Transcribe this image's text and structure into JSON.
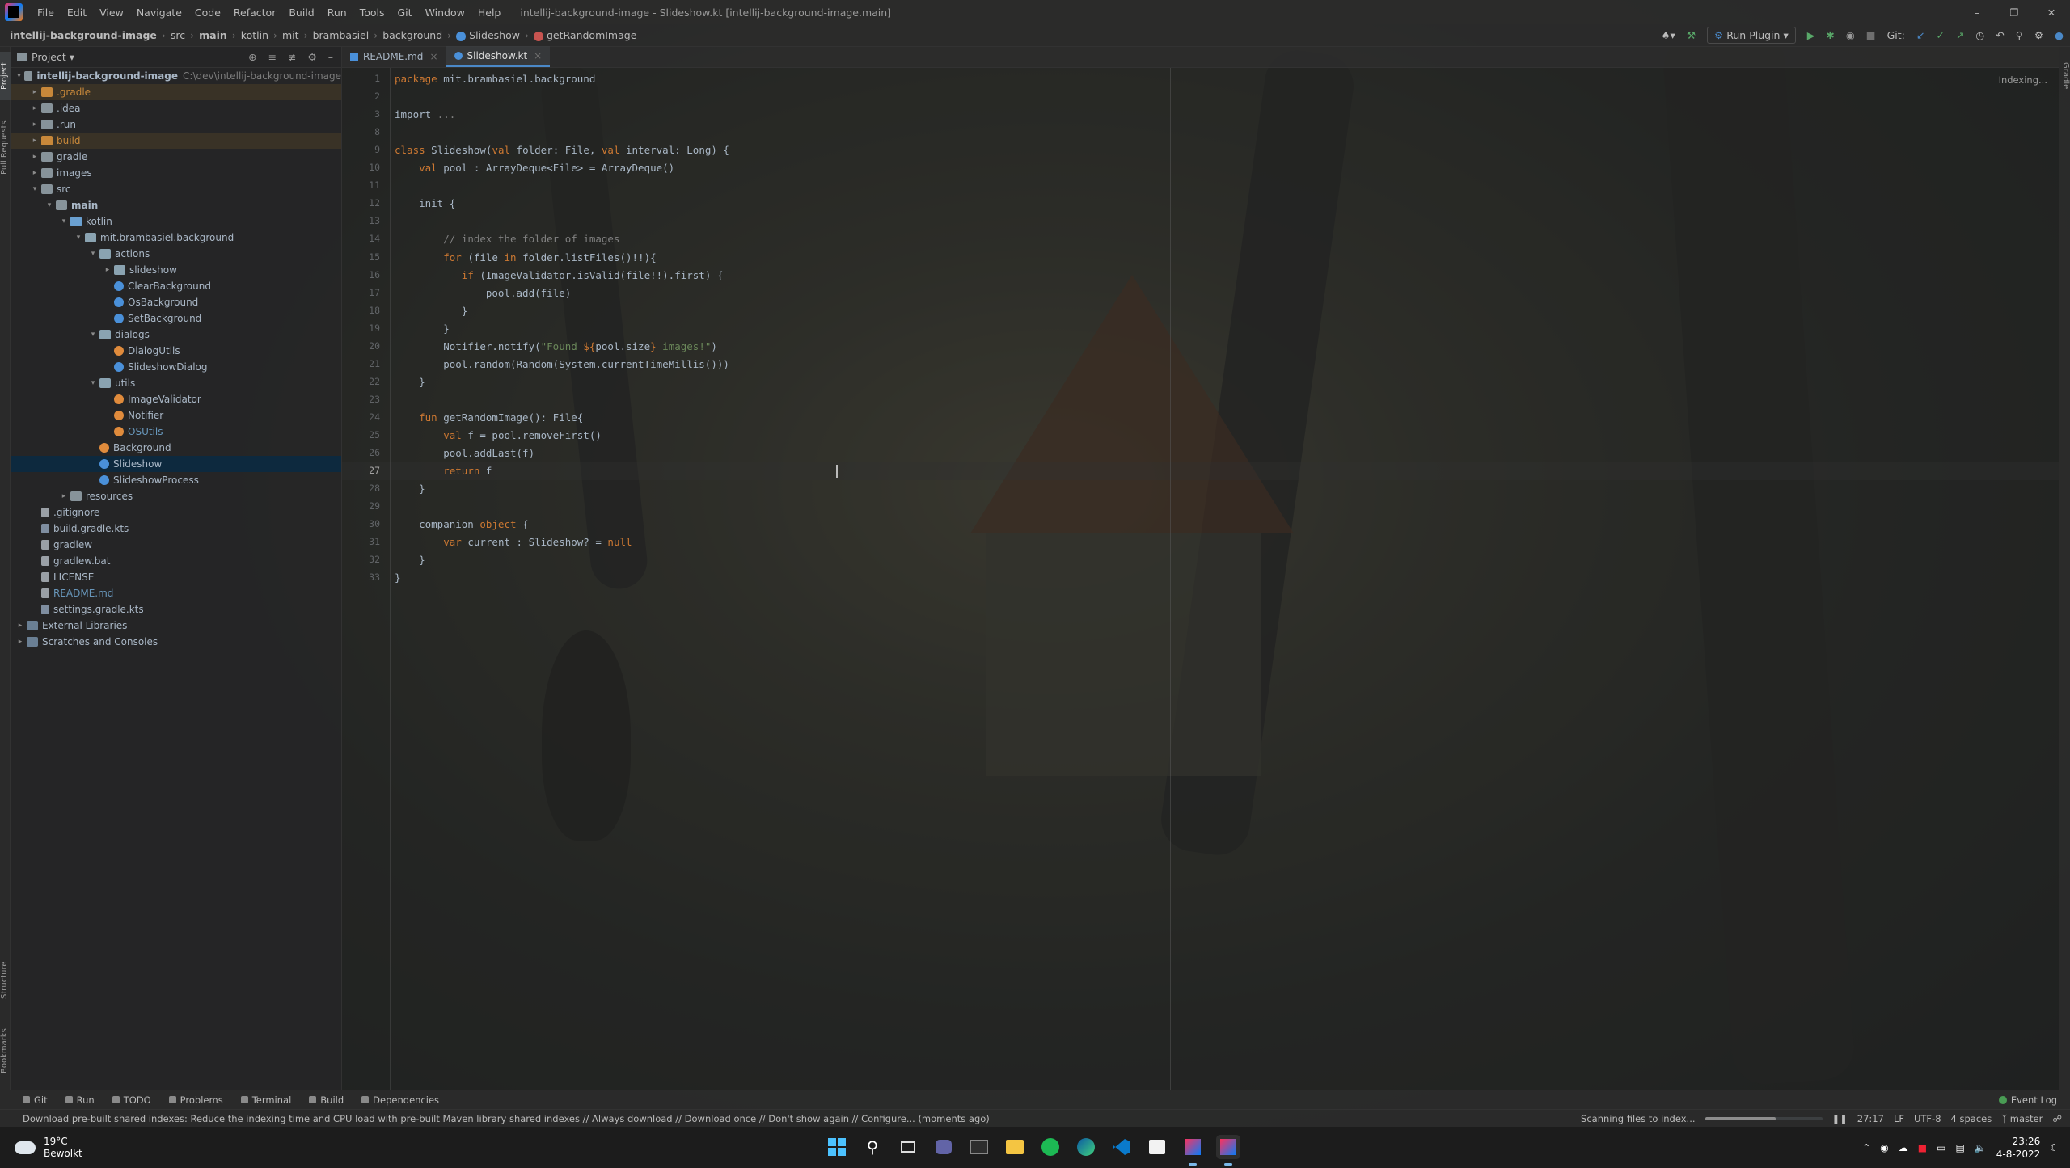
{
  "titlebar": {
    "menu": [
      "File",
      "Edit",
      "View",
      "Navigate",
      "Code",
      "Refactor",
      "Build",
      "Run",
      "Tools",
      "Git",
      "Window",
      "Help"
    ],
    "title": "intellij-background-image - Slideshow.kt [intellij-background-image.main]"
  },
  "breadcrumb": [
    "intellij-background-image",
    "src",
    "main",
    "kotlin",
    "mit",
    "brambasiel",
    "background",
    "Slideshow",
    "getRandomImage"
  ],
  "toolbar": {
    "run_config": "Run Plugin",
    "git_label": "Git:"
  },
  "project": {
    "header": "Project",
    "tree": [
      {
        "label": "intellij-background-image",
        "path": "C:\\dev\\intellij-background-image",
        "depth": 0,
        "icon": "folder",
        "open": true,
        "bold": true
      },
      {
        "label": ".gradle",
        "depth": 1,
        "icon": "folder-orange",
        "color": "#c8883a",
        "hl": true
      },
      {
        "label": ".idea",
        "depth": 1,
        "icon": "folder"
      },
      {
        "label": ".run",
        "depth": 1,
        "icon": "folder"
      },
      {
        "label": "build",
        "depth": 1,
        "icon": "folder-orange",
        "color": "#c8883a",
        "hl": true
      },
      {
        "label": "gradle",
        "depth": 1,
        "icon": "folder"
      },
      {
        "label": "images",
        "depth": 1,
        "icon": "folder"
      },
      {
        "label": "src",
        "depth": 1,
        "icon": "folder",
        "open": true
      },
      {
        "label": "main",
        "depth": 2,
        "icon": "folder",
        "open": true,
        "bold": true
      },
      {
        "label": "kotlin",
        "depth": 3,
        "icon": "folder-blue",
        "open": true
      },
      {
        "label": "mit.brambasiel.background",
        "depth": 4,
        "icon": "pkg",
        "open": true
      },
      {
        "label": "actions",
        "depth": 5,
        "icon": "pkg",
        "open": true
      },
      {
        "label": "slideshow",
        "depth": 6,
        "icon": "pkg"
      },
      {
        "label": "ClearBackground",
        "depth": 6,
        "icon": "kt",
        "leaf": true
      },
      {
        "label": "OsBackground",
        "depth": 6,
        "icon": "kt",
        "leaf": true
      },
      {
        "label": "SetBackground",
        "depth": 6,
        "icon": "kt",
        "leaf": true
      },
      {
        "label": "dialogs",
        "depth": 5,
        "icon": "pkg",
        "open": true
      },
      {
        "label": "DialogUtils",
        "depth": 6,
        "icon": "kto",
        "leaf": true
      },
      {
        "label": "SlideshowDialog",
        "depth": 6,
        "icon": "kt",
        "leaf": true
      },
      {
        "label": "utils",
        "depth": 5,
        "icon": "pkg",
        "open": true
      },
      {
        "label": "ImageValidator",
        "depth": 6,
        "icon": "kto",
        "leaf": true
      },
      {
        "label": "Notifier",
        "depth": 6,
        "icon": "kto",
        "leaf": true
      },
      {
        "label": "OSUtils",
        "depth": 6,
        "icon": "kto",
        "leaf": true,
        "color": "#6897bb"
      },
      {
        "label": "Background",
        "depth": 5,
        "icon": "kto",
        "leaf": true
      },
      {
        "label": "Slideshow",
        "depth": 5,
        "icon": "kt",
        "leaf": true,
        "selected": true
      },
      {
        "label": "SlideshowProcess",
        "depth": 5,
        "icon": "kt",
        "leaf": true
      },
      {
        "label": "resources",
        "depth": 3,
        "icon": "folder"
      },
      {
        "label": ".gitignore",
        "depth": 1,
        "icon": "file",
        "leaf": true
      },
      {
        "label": "build.gradle.kts",
        "depth": 1,
        "icon": "gradle",
        "leaf": true
      },
      {
        "label": "gradlew",
        "depth": 1,
        "icon": "file",
        "leaf": true
      },
      {
        "label": "gradlew.bat",
        "depth": 1,
        "icon": "file",
        "leaf": true
      },
      {
        "label": "LICENSE",
        "depth": 1,
        "icon": "file",
        "leaf": true
      },
      {
        "label": "README.md",
        "depth": 1,
        "icon": "file",
        "leaf": true,
        "color": "#6897bb"
      },
      {
        "label": "settings.gradle.kts",
        "depth": 1,
        "icon": "gradle",
        "leaf": true
      },
      {
        "label": "External Libraries",
        "depth": 0,
        "icon": "lib"
      },
      {
        "label": "Scratches and Consoles",
        "depth": 0,
        "icon": "lib"
      }
    ]
  },
  "tabs": [
    {
      "label": "README.md",
      "active": false
    },
    {
      "label": "Slideshow.kt",
      "active": true
    }
  ],
  "editor": {
    "status": "Indexing...",
    "current_line": 27,
    "lines": [
      [
        [
          "kw",
          "package"
        ],
        [
          "t",
          " mit.brambasiel.background"
        ]
      ],
      [],
      [
        [
          "t",
          "import "
        ],
        [
          "cmt",
          "..."
        ]
      ],
      [],
      [
        [
          "kw",
          "class"
        ],
        [
          "t",
          " Slideshow("
        ],
        [
          "kw",
          "val"
        ],
        [
          "t",
          " folder: File, "
        ],
        [
          "kw",
          "val"
        ],
        [
          "t",
          " interval: Long) {"
        ]
      ],
      [
        [
          "t",
          "    "
        ],
        [
          "kw",
          "val"
        ],
        [
          "t",
          " pool : ArrayDeque<File> = ArrayDeque()"
        ]
      ],
      [],
      [
        [
          "t",
          "    init {"
        ]
      ],
      [],
      [
        [
          "t",
          "        "
        ],
        [
          "cmt",
          "// index the folder of images"
        ]
      ],
      [
        [
          "t",
          "        "
        ],
        [
          "kw",
          "for"
        ],
        [
          "t",
          " (file "
        ],
        [
          "kw",
          "in"
        ],
        [
          "t",
          " folder.listFiles()!!){"
        ]
      ],
      [
        [
          "t",
          "           "
        ],
        [
          "kw",
          "if"
        ],
        [
          "t",
          " (ImageValidator.isValid(file!!).first) {"
        ]
      ],
      [
        [
          "t",
          "               pool.add(file)"
        ]
      ],
      [
        [
          "t",
          "           }"
        ]
      ],
      [
        [
          "t",
          "        }"
        ]
      ],
      [
        [
          "t",
          "        Notifier.notify("
        ],
        [
          "str",
          "\"Found "
        ],
        [
          "kw",
          "${"
        ],
        [
          "t",
          "pool.size"
        ],
        [
          "kw",
          "}"
        ],
        [
          "str",
          " images!\""
        ],
        [
          "t",
          ")"
        ]
      ],
      [
        [
          "t",
          "        pool.random(Random(System.currentTimeMillis()))"
        ]
      ],
      [
        [
          "t",
          "    }"
        ]
      ],
      [],
      [
        [
          "t",
          "    "
        ],
        [
          "kw",
          "fun"
        ],
        [
          "t",
          " getRandomImage(): File{"
        ]
      ],
      [
        [
          "t",
          "        "
        ],
        [
          "kw",
          "val"
        ],
        [
          "t",
          " f = pool.removeFirst()"
        ]
      ],
      [
        [
          "t",
          "        pool.addLast(f)"
        ]
      ],
      [
        [
          "t",
          "        "
        ],
        [
          "kw",
          "return"
        ],
        [
          "t",
          " f"
        ]
      ],
      [
        [
          "t",
          "    }"
        ]
      ],
      [],
      [
        [
          "t",
          "    companion "
        ],
        [
          "kw",
          "object"
        ],
        [
          "t",
          " {"
        ]
      ],
      [
        [
          "t",
          "        "
        ],
        [
          "kw",
          "var"
        ],
        [
          "t",
          " current : Slideshow? = "
        ],
        [
          "kw",
          "null"
        ]
      ],
      [
        [
          "t",
          "    }"
        ]
      ],
      [
        [
          "t",
          "}"
        ]
      ]
    ],
    "line_numbers": [
      1,
      2,
      3,
      8,
      9,
      10,
      11,
      12,
      13,
      14,
      15,
      16,
      17,
      18,
      19,
      20,
      21,
      22,
      23,
      24,
      25,
      26,
      27,
      28,
      29,
      30,
      31,
      32,
      33
    ]
  },
  "bottom_tools": [
    "Git",
    "Run",
    "TODO",
    "Problems",
    "Terminal",
    "Build",
    "Dependencies"
  ],
  "event_log": "Event Log",
  "statusbar": {
    "message": "Download pre-built shared indexes: Reduce the indexing time and CPU load with pre-built Maven library shared indexes // Always download // Download once // Don't show again // Configure... (moments ago)",
    "scanning": "Scanning files to index...",
    "progress": 0.6,
    "position": "27:17",
    "line_sep": "LF",
    "encoding": "UTF-8",
    "indent": "4 spaces",
    "branch": "master"
  },
  "left_strip": [
    "Project",
    "Pull Requests",
    "Structure",
    "Bookmarks"
  ],
  "right_strip": [
    "Gradle"
  ],
  "taskbar": {
    "temp": "19°C",
    "condition": "Bewolkt",
    "time": "23:26",
    "date": "4-8-2022"
  },
  "colors": {
    "accent": "#4a88c7",
    "selection": "#0d293e",
    "keyword": "#cc7832",
    "string": "#6a8759",
    "comment": "#808080"
  }
}
